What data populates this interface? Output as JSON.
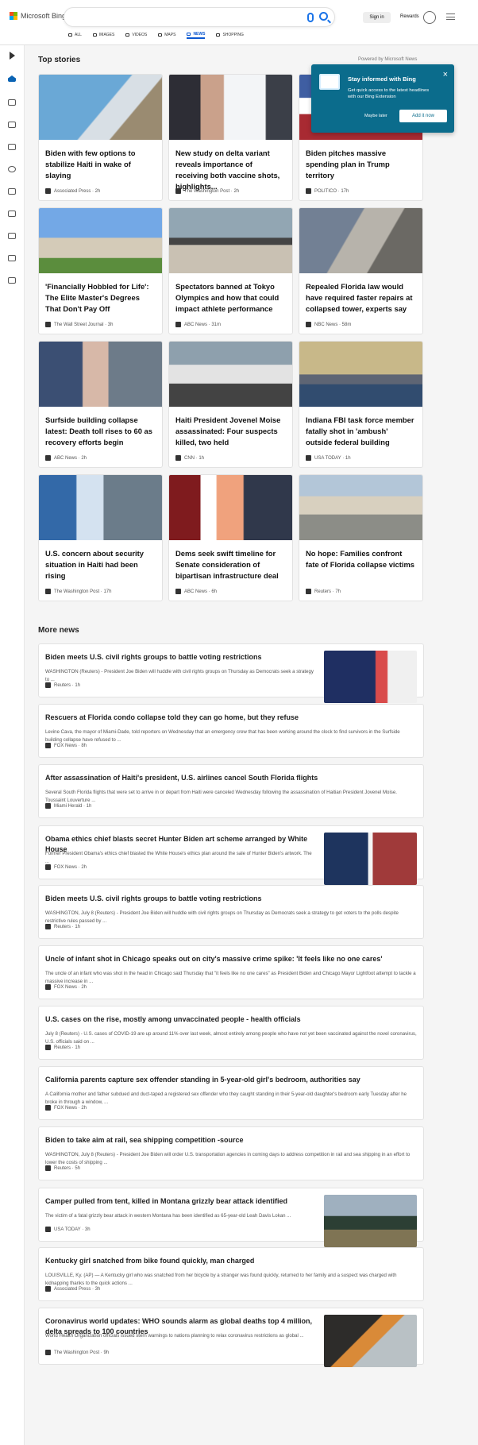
{
  "brand": {
    "name": "Microsoft Bing"
  },
  "header": {
    "sign_in": "Sign in",
    "rewards": "Rewards"
  },
  "nav": [
    {
      "label": "ALL",
      "icon": "search-icon",
      "active": false
    },
    {
      "label": "IMAGES",
      "icon": "image-icon",
      "active": false
    },
    {
      "label": "VIDEOS",
      "icon": "video-icon",
      "active": false
    },
    {
      "label": "MAPS",
      "icon": "map-pin-icon",
      "active": false
    },
    {
      "label": "NEWS",
      "icon": "news-icon",
      "active": true
    },
    {
      "label": "SHOPPING",
      "icon": "shopping-icon",
      "active": false
    }
  ],
  "top_stories": {
    "title": "Top stories",
    "powered": "Powered by Microsoft News",
    "cards": [
      {
        "title": "Biden with few options to stabilize Haiti in wake of slaying",
        "source": "Associated Press · 2h",
        "image": "img-stairs"
      },
      {
        "title": "New study on delta variant reveals importance of receiving both vaccine shots, highlights...",
        "source": "The Washington Post · 2h",
        "image": "img-vax"
      },
      {
        "title": "Biden pitches massive spending plan in Trump territory",
        "source": "POLITICO · 17h",
        "image": "img-trump"
      },
      {
        "title": "'Financially Hobbled for Life': The Elite Master's Degrees That Don't Pay Off",
        "source": "The Wall Street Journal · 3h",
        "image": "img-columbia"
      },
      {
        "title": "Spectators banned at Tokyo Olympics and how that could impact athlete performance",
        "source": "ABC News · 31m",
        "image": "img-olympics"
      },
      {
        "title": "Repealed Florida law would have required faster repairs at collapsed tower, experts say",
        "source": "NBC News · 58m",
        "image": "img-collapse"
      },
      {
        "title": "Surfside building collapse latest: Death toll rises to 60 as recovery efforts begin",
        "source": "ABC News · 2h",
        "image": "img-hug"
      },
      {
        "title": "Haiti President Jovenel Moise assassinated: Four suspects killed, two held",
        "source": "CNN · 1h",
        "image": "img-haiti"
      },
      {
        "title": "Indiana FBI task force member fatally shot in 'ambush' outside federal building",
        "source": "USA TODAY · 1h",
        "image": "img-building"
      },
      {
        "title": "U.S. concern about security situation in Haiti had been rising",
        "source": "The Washington Post · 17h",
        "image": "img-opah"
      },
      {
        "title": "Dems seek swift timeline for Senate consideration of bipartisan infrastructure deal",
        "source": "ABC News · 6h",
        "image": "img-pelosi"
      },
      {
        "title": "No hope: Families confront fate of Florida collapse victims",
        "source": "Reuters · 7h",
        "image": "img-collapse2"
      }
    ]
  },
  "popup": {
    "title": "Stay informed with Bing",
    "body": "Get quick access to the latest headlines with our Bing Extension",
    "maybe": "Maybe later",
    "add": "Add it now"
  },
  "more_news": {
    "title": "More news",
    "items": [
      {
        "title": "Biden meets U.S. civil rights groups to battle voting restrictions",
        "summary": "WASHINGTON (Reuters) - President Joe Biden will huddle with civil rights groups on Thursday as Democrats seek a strategy to ...",
        "source": "Reuters · 1h",
        "image": "img-biden"
      },
      {
        "title": "Rescuers at Florida condo collapse told they can go home, but they refuse",
        "summary": "Levine Cava, the mayor of Miami-Dade, told reporters on Wednesday that an emergency crew that has been working around the clock to find survivors in the Surfside building collapse have refused to ...",
        "source": "FOX News · 8h",
        "image": ""
      },
      {
        "title": "After assassination of Haiti's president, U.S. airlines cancel South Florida flights",
        "summary": "Several South Florida flights that were set to arrive in or depart from Haiti were canceled Wednesday following the assassination of Haitian President Jovenel Moise. Toussaint Louverture ...",
        "source": "Miami Herald · 1h",
        "image": ""
      },
      {
        "title": "Obama ethics chief blasts secret Hunter Biden art scheme arranged by White House",
        "summary": "Former President Obama's ethics chief blasted the White House's ethics plan around the sale of Hunter Biden's artwork. The ...",
        "source": "FOX News · 2h",
        "image": "img-debate"
      },
      {
        "title": "Biden meets U.S. civil rights groups to battle voting restrictions",
        "summary": "WASHINGTON, July 8 (Reuters) - President Joe Biden will huddle with civil rights groups on Thursday as Democrats seek a strategy to get voters to the polls despite restrictive rules passed by ...",
        "source": "Reuters · 1h",
        "image": ""
      },
      {
        "title": "Uncle of infant shot in Chicago speaks out on city's massive crime spike: 'It feels like no one cares'",
        "summary": "The uncle of an infant who was shot in the head in Chicago said Thursday that \"it feels like no one cares\" as President Biden and Chicago Mayor Lightfoot attempt to tackle a massive increase in ...",
        "source": "FOX News · 2h",
        "image": ""
      },
      {
        "title": "U.S. cases on the rise, mostly among unvaccinated people - health officials",
        "summary": "July 8 (Reuters) - U.S. cases of COVID-19 are up around 11% over last week, almost entirely among people who have not yet been vaccinated against the novel coronavirus, U.S. officials said on ...",
        "source": "Reuters · 1h",
        "image": ""
      },
      {
        "title": "California parents capture sex offender standing in 5-year-old girl's bedroom, authorities say",
        "summary": "A California mother and father subdued and duct-taped a registered sex offender who they caught standing in their 5-year-old daughter's bedroom early Tuesday after he broke in through a window, ...",
        "source": "FOX News · 2h",
        "image": ""
      },
      {
        "title": "Biden to take aim at rail, sea shipping competition -source",
        "summary": "WASHINGTON, July 8 (Reuters) - President Joe Biden will order U.S. transportation agencies in coming days to address competition in rail and sea shipping in an effort to lower the costs of shipping ...",
        "source": "Reuters · 5h",
        "image": ""
      },
      {
        "title": "Camper pulled from tent, killed in Montana grizzly bear attack identified",
        "summary": "The victim of a fatal grizzly bear attack in western Montana has been identified as 65-year-old Leah Davis Lokan ...",
        "source": "USA TODAY · 3h",
        "image": "img-forest"
      },
      {
        "title": "Kentucky girl snatched from bike found quickly, man charged",
        "summary": "LOUISVILLE, Ky. (AP) — A Kentucky girl who was snatched from her bicycle by a stranger was found quickly, returned to her family and a suspect was charged with kidnapping thanks to the quick actions ...",
        "source": "Associated Press · 3h",
        "image": ""
      },
      {
        "title": "Coronavirus world updates: WHO sounds alarm as global deaths top 4 million, delta spreads to 100 countries",
        "summary": "World Health Organization officials issued stern warnings to nations planning to relax coronavirus restrictions as global ...",
        "source": "The Washington Post · 9h",
        "image": "img-fire"
      }
    ]
  }
}
